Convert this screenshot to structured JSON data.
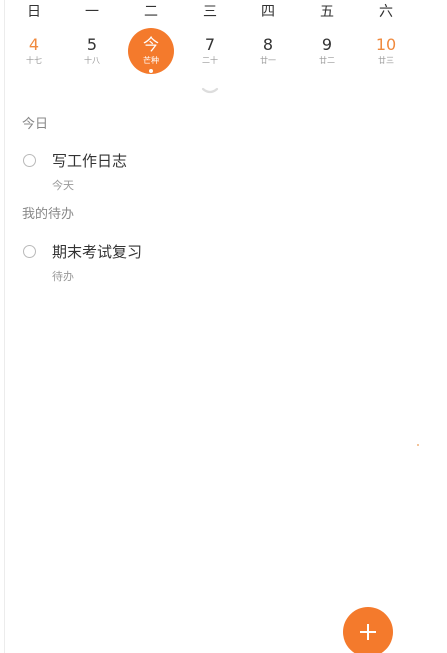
{
  "weekdays": [
    "日",
    "一",
    "二",
    "三",
    "四",
    "五",
    "六"
  ],
  "dates": [
    {
      "num": "4",
      "lunar": "十七"
    },
    {
      "num": "5",
      "lunar": "十八"
    },
    {
      "num": "今",
      "lunar": "芒种"
    },
    {
      "num": "7",
      "lunar": "二十"
    },
    {
      "num": "8",
      "lunar": "廿一"
    },
    {
      "num": "9",
      "lunar": "廿二"
    },
    {
      "num": "10",
      "lunar": "廿三"
    }
  ],
  "sections": [
    {
      "title": "今日",
      "items": [
        {
          "title": "写工作日志",
          "subtitle": "今天"
        }
      ]
    },
    {
      "title": "我的待办",
      "items": [
        {
          "title": "期末考试复习",
          "subtitle": "待办"
        }
      ]
    }
  ],
  "colors": {
    "accent": "#f47a2c",
    "weekend": "#f08a3e",
    "text": "#333333",
    "muted": "#999999"
  },
  "icons": {
    "expand": "chevron-down-icon",
    "add": "plus-icon",
    "checkbox": "circle-outline-icon"
  }
}
